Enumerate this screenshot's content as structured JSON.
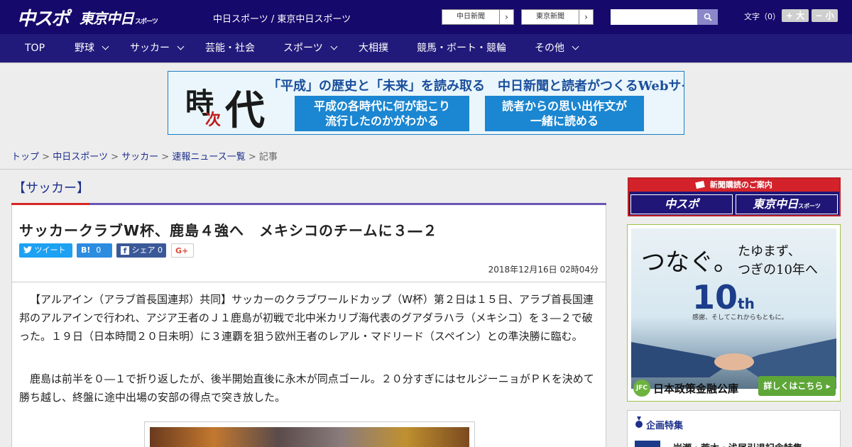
{
  "header": {
    "logo_chuspo": "中スポ",
    "logo_tokyo": "東京中日",
    "logo_tokyo_small": "スポーツ",
    "site_name": "中日スポーツ / 東京中日スポーツ",
    "paper_links": [
      "中日新聞",
      "東京新聞"
    ],
    "search_placeholder": "",
    "font_size_label": "文字（0）",
    "font_bigger": "+ 大",
    "font_smaller": "− 小"
  },
  "nav": {
    "items": [
      {
        "label": "TOP",
        "dropdown": false
      },
      {
        "label": "野球",
        "dropdown": true
      },
      {
        "label": "サッカー",
        "dropdown": true
      },
      {
        "label": "芸能・社会",
        "dropdown": false
      },
      {
        "label": "スポーツ",
        "dropdown": true
      },
      {
        "label": "大相撲",
        "dropdown": false
      },
      {
        "label": "競馬・ボート・競輪",
        "dropdown": false
      },
      {
        "label": "その他",
        "dropdown": true
      }
    ]
  },
  "banner": {
    "title_ji": "時",
    "title_tsugi": "次",
    "title_dai": "代",
    "headline": "「平成」の歴史と「未来」を読み取る　中日新聞と読者がつくるWebサイト",
    "box1": [
      "平成の各時代に何が起こり",
      "流行したのかがわかる"
    ],
    "box2": [
      "読者からの思い出作文が",
      "一緒に読める"
    ]
  },
  "breadcrumb": {
    "items": [
      "トップ",
      "中日スポーツ",
      "サッカー",
      "速報ニュース一覧"
    ],
    "current": "記事",
    "separator": ">"
  },
  "category": "【サッカー】",
  "article": {
    "headline": "サッカークラブW杯、鹿島４強へ　メキシコのチームに３―２",
    "share": {
      "tweet": "ツイート",
      "hatena": "B!",
      "hatena_count": "0",
      "facebook": "シェア",
      "facebook_count": "0",
      "google": "G+"
    },
    "date": "2018年12月16日 02時04分",
    "paragraphs": [
      "【アルアイン（アラブ首長国連邦）共同】サッカーのクラブワールドカップ（W杯）第２日は１５日、アラブ首長国連邦のアルアインで行われ、アジア王者のＪ１鹿島が初戦で北中米カリブ海代表のグアダラハラ（メキシコ）を３―２で破った。１９日（日本時間２０日未明）に３連覇を狙う欧州王者のレアル・マドリード（スペイン）との準決勝に臨む。",
      "鹿島は前半を０―１で折り返したが、後半開始直後に永木が同点ゴール。２０分すぎにはセルジーニョがＰＫを決めて勝ち越し、終盤に途中出場の安部の得点で突き放した。"
    ]
  },
  "sidebar": {
    "subscribe_head": "新聞購読のご案内",
    "subscribe_logo1": "中スポ",
    "subscribe_logo2": "東京中日",
    "subscribe_logo2_small": "スポーツ",
    "ad": {
      "catch1": "つなぐ。",
      "catch2": [
        "たゆまず、",
        "つぎの10年へ"
      ],
      "tenth": "10",
      "tenth_suffix": "th",
      "tenth_sub": "感謝、そしてこれからもともに。",
      "jfc_mark": "JFC",
      "jfc_name": "日本政策金融公庫",
      "cta": "詳しくはこちら ▸"
    },
    "special_head": "企画特集",
    "special_item": "岩瀬・荒木・浅尾引退記念特集"
  },
  "colors": {
    "header_bg": "#15096b",
    "nav_bg": "#221a7a",
    "accent_purple": "#6c54b5",
    "accent_red": "#d52525",
    "twitter": "#1da1f2",
    "hatena": "#2c8ce0",
    "facebook": "#3b5998"
  }
}
